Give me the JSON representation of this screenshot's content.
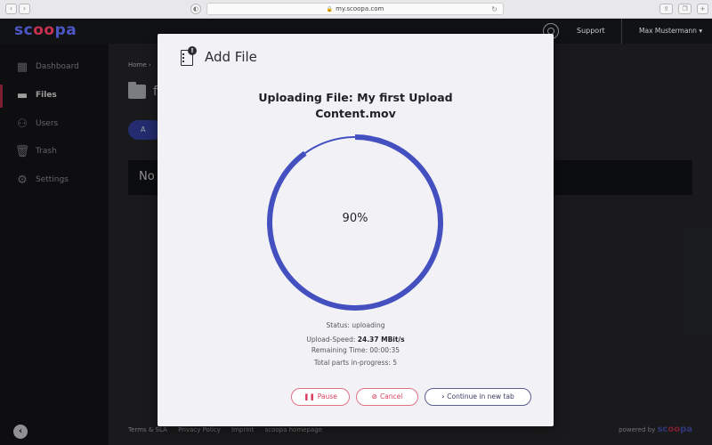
{
  "browser": {
    "url": "my.scoopa.com",
    "back_glyph": "‹",
    "forward_glyph": "›",
    "shield_glyph": "◐",
    "lock_glyph": "🔒",
    "reload_glyph": "↻",
    "share_glyph": "⇪",
    "tabs_glyph": "❐",
    "new_tab_glyph": "+"
  },
  "app": {
    "logo_a": "sc",
    "logo_b": "oo",
    "logo_c": "pa",
    "support_label": "Support",
    "user_name": "Max Mustermann ▾"
  },
  "sidebar": {
    "items": [
      {
        "label": "Dashboard",
        "icon": "dashboard-icon",
        "glyph": "▦"
      },
      {
        "label": "Files",
        "icon": "folder-icon",
        "glyph": "▬"
      },
      {
        "label": "Users",
        "icon": "users-icon",
        "glyph": "⚇"
      },
      {
        "label": "Trash",
        "icon": "trash-icon",
        "glyph": "🗑"
      },
      {
        "label": "Settings",
        "icon": "gear-icon",
        "glyph": "⚙"
      }
    ],
    "active": "Files",
    "collapse_glyph": "‹"
  },
  "main": {
    "breadcrumb": "Home ›",
    "folder_title": "f",
    "add_button_label": "A",
    "empty_text": "No",
    "footer_links": [
      "Terms & SLA",
      "Privacy Policy",
      "Imprint",
      "scoopa homepage"
    ],
    "powered_by": "powered by",
    "powered_logo_a": "sc",
    "powered_logo_b": "oo",
    "powered_logo_c": "pa"
  },
  "modal": {
    "title": "Add File",
    "badge_glyph": "!",
    "upload_title_line1": "Uploading File: My first Upload",
    "upload_title_line2": "Content.mov",
    "progress": 0.9,
    "progress_label": "90%",
    "progress_color": "#4550c0",
    "status": "Status: uploading",
    "upload_speed_label": "Upload-Speed: ",
    "upload_speed_value": "24.37 MBit/s",
    "remaining_time": "Remaining Time: 00:00:35",
    "parts_in_progress": "Total parts in-progress: 5",
    "buttons": {
      "pause_glyph": "❚❚",
      "pause_label": "Pause",
      "cancel_glyph": "⊘",
      "cancel_label": "Cancel",
      "continue_glyph": "›",
      "continue_label": "Continue in new tab"
    }
  },
  "colors": {
    "accent": "#4550c0",
    "danger": "#d9405f",
    "brand_blue": "#4c57c4",
    "brand_red": "#c8304f"
  }
}
